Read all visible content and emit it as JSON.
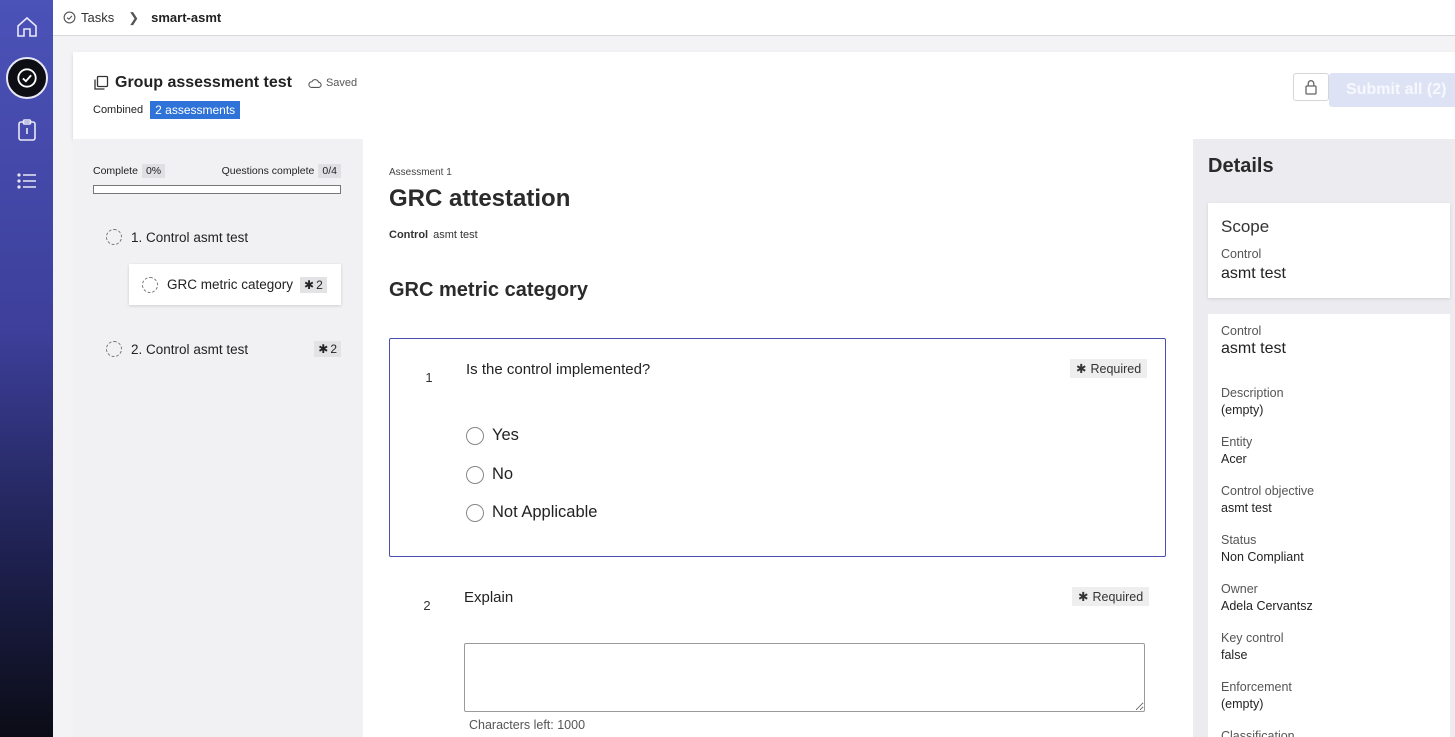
{
  "rail": {
    "items": [
      {
        "name": "home-icon"
      },
      {
        "name": "tasks-check-icon"
      },
      {
        "name": "clipboard-icon"
      },
      {
        "name": "list-icon"
      }
    ]
  },
  "breadcrumb": {
    "root": "Tasks",
    "current": "smart-asmt"
  },
  "header": {
    "title": "Group assessment test",
    "saved_label": "Saved",
    "combined_label": "Combined",
    "assessments_badge": "2 assessments",
    "submit_label": "Submit all (2)"
  },
  "leftnav": {
    "complete_label": "Complete",
    "complete_value": "0%",
    "questions_label": "Questions complete",
    "questions_value": "0/4",
    "progress_fraction": 0,
    "items": [
      {
        "number": "1.",
        "type": "Control",
        "name": "asmt test"
      },
      {
        "number": "2.",
        "type": "Control",
        "name": "asmt test",
        "required_count": "2"
      }
    ],
    "child": {
      "label": "GRC metric category",
      "required_count": "2"
    }
  },
  "main": {
    "assessment_label": "Assessment 1",
    "title": "GRC attestation",
    "scope_type": "Control",
    "scope_name": "asmt test",
    "section_title": "GRC metric category",
    "questions": [
      {
        "number": "1",
        "text": "Is the control implemented?",
        "required_label": "Required",
        "options": [
          "Yes",
          "No",
          "Not Applicable"
        ]
      },
      {
        "number": "2",
        "text": "Explain",
        "required_label": "Required",
        "chars_left": "Characters left: 1000"
      }
    ]
  },
  "details": {
    "title": "Details",
    "scope": {
      "title": "Scope",
      "label": "Control",
      "value": "asmt test"
    },
    "fields": [
      {
        "label": "Control",
        "value": "asmt test"
      },
      {
        "label": "Description",
        "value": "(empty)"
      },
      {
        "label": "Entity",
        "value": "Acer"
      },
      {
        "label": "Control objective",
        "value": "asmt test"
      },
      {
        "label": "Status",
        "value": "Non Compliant"
      },
      {
        "label": "Owner",
        "value": "Adela Cervantsz"
      },
      {
        "label": "Key control",
        "value": "false"
      },
      {
        "label": "Enforcement",
        "value": "(empty)"
      },
      {
        "label": "Classification",
        "value": ""
      }
    ]
  },
  "colors": {
    "accent": "#4a4fb0",
    "badge_blue": "#2f73d9",
    "submit_disabled": "#dde3f5"
  }
}
